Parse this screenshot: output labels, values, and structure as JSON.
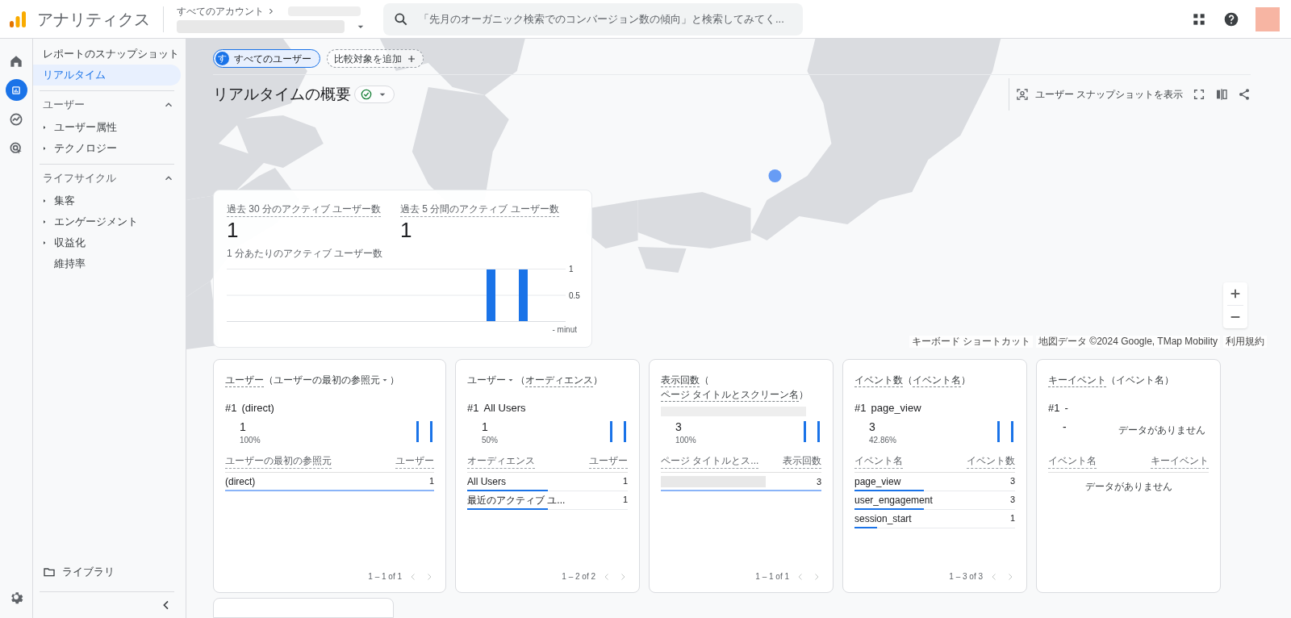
{
  "header": {
    "product": "アナリティクス",
    "breadcrumb": "すべてのアカウント",
    "search_placeholder": "「先月のオーガニック検索でのコンバージョン数の傾向」と検索してみてく..."
  },
  "rail": [
    {
      "kind": "home",
      "selected": false
    },
    {
      "kind": "reports",
      "selected": true
    },
    {
      "kind": "explore",
      "selected": false
    },
    {
      "kind": "advertising",
      "selected": false
    }
  ],
  "nav": {
    "items": [
      {
        "label": "レポートのスナップショット",
        "selected": false
      },
      {
        "label": "リアルタイム",
        "selected": true
      }
    ],
    "sections": [
      {
        "title": "ユーザー",
        "expanded": true,
        "items": [
          {
            "label": "ユーザー属性",
            "expandable": true
          },
          {
            "label": "テクノロジー",
            "expandable": true
          }
        ]
      },
      {
        "title": "ライフサイクル",
        "expanded": true,
        "items": [
          {
            "label": "集客",
            "expandable": true
          },
          {
            "label": "エンゲージメント",
            "expandable": true
          },
          {
            "label": "収益化",
            "expandable": true
          },
          {
            "label": "維持率",
            "expandable": false
          }
        ]
      }
    ],
    "library": "ライブラリ"
  },
  "comparisons": [
    {
      "kind": "segment",
      "badge": "す",
      "label": "すべてのユーザー"
    },
    {
      "kind": "add",
      "label": "比較対象を追加"
    }
  ],
  "report_title": "リアルタイムの概要",
  "snapshot_button": "ユーザー スナップショットを表示",
  "map": {
    "kind": "picture",
    "attribution": [
      "キーボード ショートカット",
      "地図データ ©2024 Google, TMap Mobility",
      "利用規約"
    ]
  },
  "overview": {
    "metrics": [
      {
        "label": "過去 30 分のアクティブ ユーザー数",
        "value": "1"
      },
      {
        "label": "過去 5 分間のアクティブ ユーザー数",
        "value": "1"
      }
    ],
    "chart_title": "1 分あたりのアクティブ ユーザー数",
    "axis_note": "- minut",
    "chart": {
      "kind": "picture",
      "tick_labels": [
        "1",
        "0.5"
      ]
    }
  },
  "cards": [
    {
      "title": [
        {
          "text": "ユーザー",
          "dotted": true
        },
        {
          "text": "（ユーザーの最初の参照元",
          "dotted": false,
          "dropdown": true
        },
        {
          "text": "）",
          "dotted": false
        }
      ],
      "top": {
        "rank": "#1",
        "name": "(direct)",
        "value": "1",
        "percent": "100%"
      },
      "columns": [
        "ユーザーの最初の参照元",
        "ユーザー"
      ],
      "rows": [
        {
          "label": "(direct)",
          "value": "1",
          "level": 1
        }
      ],
      "pager": "1 – 1 of 1"
    },
    {
      "title": [
        {
          "text": "ユーザー",
          "dotted": false,
          "dropdown": true
        },
        {
          "text": "（",
          "dotted": false
        },
        {
          "text": "オーディエンス",
          "dotted": true
        },
        {
          "text": "）",
          "dotted": false
        }
      ],
      "top": {
        "rank": "#1",
        "name": "All Users",
        "value": "1",
        "percent": "50%"
      },
      "columns": [
        "オーディエンス",
        "ユーザー"
      ],
      "rows": [
        {
          "label": "All Users",
          "value": "1",
          "level": 0.5
        },
        {
          "label": "最近のアクティブ ユ...",
          "value": "1",
          "level": 0.5
        }
      ],
      "pager": "1 – 2 of 2"
    },
    {
      "title": [
        {
          "text": "表示回数",
          "dotted": true
        },
        {
          "text": "（",
          "dotted": false
        },
        {
          "text": "ページ タイトルとスクリーン名",
          "dotted": true
        },
        {
          "text": "）",
          "dotted": false
        }
      ],
      "top": {
        "rank_redacted": true,
        "value": "3",
        "percent": "100%"
      },
      "columns": [
        "ページ タイトルとス...",
        "表示回数"
      ],
      "rows": [
        {
          "label_redacted": true,
          "value": "3",
          "level": 1
        }
      ],
      "pager": "1 – 1 of 1"
    },
    {
      "title": [
        {
          "text": "イベント数",
          "dotted": true
        },
        {
          "text": "（",
          "dotted": false
        },
        {
          "text": "イベント名",
          "dotted": true
        },
        {
          "text": "）",
          "dotted": false
        }
      ],
      "top": {
        "rank": "#1",
        "name": "page_view",
        "value": "3",
        "percent": "42.86%"
      },
      "columns": [
        "イベント名",
        "イベント数"
      ],
      "rows": [
        {
          "label": "page_view",
          "value": "3",
          "level": 0.43
        },
        {
          "label": "user_engagement",
          "value": "3",
          "level": 0.43
        },
        {
          "label": "session_start",
          "value": "1",
          "level": 0.14
        }
      ],
      "pager": "1 – 3 of 3"
    },
    {
      "title": [
        {
          "text": "キーイベント",
          "dotted": true
        },
        {
          "text": "（イベント名）",
          "dotted": false
        }
      ],
      "top": {
        "rank": "#1",
        "name": "-",
        "value": "-",
        "empty": "データがありません"
      },
      "columns": [
        "イベント名",
        "キーイベント"
      ],
      "empty": "データがありません"
    }
  ]
}
